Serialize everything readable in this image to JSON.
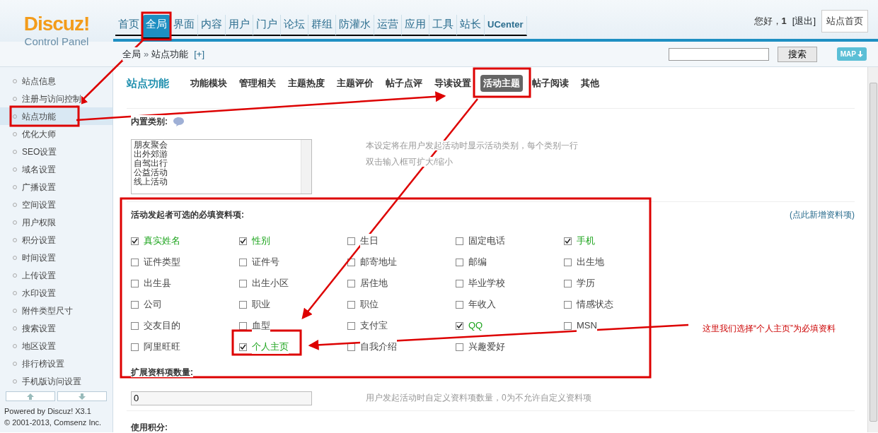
{
  "header": {
    "logo": {
      "title": "Discuz!",
      "subtitle": "Control Panel"
    },
    "nav": [
      {
        "label": "首页",
        "selected": false
      },
      {
        "label": "全局",
        "selected": true
      },
      {
        "label": "界面",
        "selected": false
      },
      {
        "label": "内容",
        "selected": false
      },
      {
        "label": "用户",
        "selected": false
      },
      {
        "label": "门户",
        "selected": false
      },
      {
        "label": "论坛",
        "selected": false
      },
      {
        "label": "群组",
        "selected": false
      },
      {
        "label": "防灌水",
        "selected": false
      },
      {
        "label": "运营",
        "selected": false
      },
      {
        "label": "应用",
        "selected": false
      },
      {
        "label": "工具",
        "selected": false
      },
      {
        "label": "站长",
        "selected": false
      },
      {
        "label": "UCenter",
        "selected": false
      }
    ],
    "greeting": "您好，",
    "username": "1",
    "logout": "[退出]",
    "home_button": "站点首页"
  },
  "breadcrumb": {
    "items": [
      "全局",
      "站点功能"
    ],
    "separator": "»",
    "add": "[+]",
    "search_button": "搜索",
    "map_button": "MAP"
  },
  "sidebar": {
    "items": [
      {
        "label": "站点信息",
        "selected": false
      },
      {
        "label": "注册与访问控制",
        "selected": false
      },
      {
        "label": "站点功能",
        "selected": true
      },
      {
        "label": "优化大师",
        "selected": false
      },
      {
        "label": "SEO设置",
        "selected": false
      },
      {
        "label": "域名设置",
        "selected": false
      },
      {
        "label": "广播设置",
        "selected": false
      },
      {
        "label": "空间设置",
        "selected": false
      },
      {
        "label": "用户权限",
        "selected": false
      },
      {
        "label": "积分设置",
        "selected": false
      },
      {
        "label": "时间设置",
        "selected": false
      },
      {
        "label": "上传设置",
        "selected": false
      },
      {
        "label": "水印设置",
        "selected": false
      },
      {
        "label": "附件类型尺寸",
        "selected": false
      },
      {
        "label": "搜索设置",
        "selected": false
      },
      {
        "label": "地区设置",
        "selected": false
      },
      {
        "label": "排行榜设置",
        "selected": false
      },
      {
        "label": "手机版访问设置",
        "selected": false
      }
    ],
    "powered_by": "Powered by",
    "product": "Discuz!",
    "version": "X3.1",
    "copyright": "© 2001-2013,",
    "company": "Comsenz Inc."
  },
  "sub_tabs": {
    "title": "站点功能",
    "tabs": [
      {
        "label": "功能模块",
        "selected": false
      },
      {
        "label": "管理相关",
        "selected": false
      },
      {
        "label": "主题热度",
        "selected": false
      },
      {
        "label": "主题评价",
        "selected": false
      },
      {
        "label": "帖子点评",
        "selected": false
      },
      {
        "label": "导读设置",
        "selected": false
      },
      {
        "label": "活动主题",
        "selected": true
      },
      {
        "label": "帖子阅读",
        "selected": false
      },
      {
        "label": "其他",
        "selected": false
      }
    ]
  },
  "builtin_categories": {
    "label": "内置类别:",
    "lines": [
      "朋友聚会",
      "出外郊游",
      "自驾出行",
      "公益活动",
      "线上活动"
    ],
    "hint": [
      "本设定将在用户发起活动时显示活动类别，每个类别一行",
      "双击输入框可扩大/缩小"
    ]
  },
  "required_fields": {
    "label": "活动发起者可选的必填资料项:",
    "add_link": "(点此新增资料项)",
    "options": [
      {
        "label": "真实姓名",
        "checked": true
      },
      {
        "label": "性别",
        "checked": true
      },
      {
        "label": "生日",
        "checked": false
      },
      {
        "label": "固定电话",
        "checked": false
      },
      {
        "label": "手机",
        "checked": true
      },
      {
        "label": "证件类型",
        "checked": false
      },
      {
        "label": "证件号",
        "checked": false
      },
      {
        "label": "邮寄地址",
        "checked": false
      },
      {
        "label": "邮编",
        "checked": false
      },
      {
        "label": "出生地",
        "checked": false
      },
      {
        "label": "出生县",
        "checked": false
      },
      {
        "label": "出生小区",
        "checked": false
      },
      {
        "label": "居住地",
        "checked": false
      },
      {
        "label": "毕业学校",
        "checked": false
      },
      {
        "label": "学历",
        "checked": false
      },
      {
        "label": "公司",
        "checked": false
      },
      {
        "label": "职业",
        "checked": false
      },
      {
        "label": "职位",
        "checked": false
      },
      {
        "label": "年收入",
        "checked": false
      },
      {
        "label": "情感状态",
        "checked": false
      },
      {
        "label": "交友目的",
        "checked": false
      },
      {
        "label": "血型",
        "checked": false
      },
      {
        "label": "支付宝",
        "checked": false
      },
      {
        "label": "QQ",
        "checked": true
      },
      {
        "label": "MSN",
        "checked": false
      },
      {
        "label": "阿里旺旺",
        "checked": false
      },
      {
        "label": "个人主页",
        "checked": true
      },
      {
        "label": "自我介绍",
        "checked": false
      },
      {
        "label": "兴趣爱好",
        "checked": false
      }
    ]
  },
  "extend_count": {
    "label": "扩展资料项数量:",
    "value": "0",
    "hint": "用户发起活动时自定义资料项数量，0为不允许自定义资料项"
  },
  "use_credits": {
    "label": "使用积分:"
  },
  "annotation_note": "这里我们选择“个人主页”为必填资料"
}
